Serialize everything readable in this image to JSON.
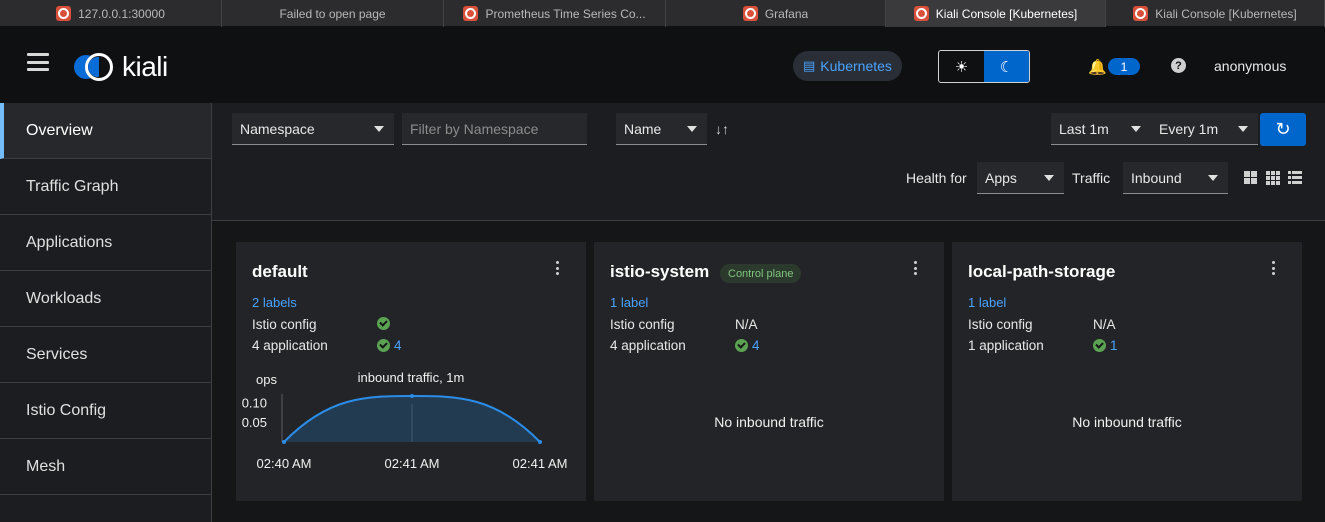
{
  "browser_tabs": [
    {
      "title": "127.0.0.1:30000",
      "favicon": true,
      "active": false
    },
    {
      "title": "Failed to open page",
      "favicon": false,
      "active": false
    },
    {
      "title": "Prometheus Time Series Co...",
      "favicon": true,
      "active": false
    },
    {
      "title": "Grafana",
      "favicon": true,
      "active": false
    },
    {
      "title": "Kiali Console [Kubernetes]",
      "favicon": true,
      "active": true
    },
    {
      "title": "Kiali Console [Kubernetes]",
      "favicon": true,
      "active": false
    }
  ],
  "masthead": {
    "logo_text": "kiali",
    "cluster": "Kubernetes",
    "notification_count": "1",
    "user": "anonymous",
    "help_glyph": "?"
  },
  "sidebar": {
    "items": [
      {
        "label": "Overview",
        "active": true
      },
      {
        "label": "Traffic Graph",
        "active": false
      },
      {
        "label": "Applications",
        "active": false
      },
      {
        "label": "Workloads",
        "active": false
      },
      {
        "label": "Services",
        "active": false
      },
      {
        "label": "Istio Config",
        "active": false
      },
      {
        "label": "Mesh",
        "active": false
      }
    ]
  },
  "toolbar": {
    "filter_type": "Namespace",
    "filter_placeholder": "Filter by Namespace",
    "sort_by": "Name",
    "time_range": "Last 1m",
    "refresh_interval": "Every 1m",
    "health_for_label": "Health for",
    "health_for_value": "Apps",
    "traffic_label": "Traffic",
    "traffic_value": "Inbound"
  },
  "cards": [
    {
      "name": "default",
      "badge": "",
      "labels_link": "2 labels",
      "istio_config_label": "Istio config",
      "istio_config_value": "",
      "istio_config_ok": true,
      "app_label": "4 application",
      "app_count": "4",
      "no_traffic": ""
    },
    {
      "name": "istio-system",
      "badge": "Control plane",
      "labels_link": "1 label",
      "istio_config_label": "Istio config",
      "istio_config_value": "N/A",
      "istio_config_ok": false,
      "app_label": "4 application",
      "app_count": "4",
      "no_traffic": "No inbound traffic"
    },
    {
      "name": "local-path-storage",
      "badge": "",
      "labels_link": "1 label",
      "istio_config_label": "Istio config",
      "istio_config_value": "N/A",
      "istio_config_ok": false,
      "app_label": "1 application",
      "app_count": "1",
      "no_traffic": "No inbound traffic"
    }
  ],
  "chart_data": {
    "type": "area",
    "title": "inbound traffic, 1m",
    "ylabel": "ops",
    "x": [
      "02:40 AM",
      "02:41 AM",
      "02:41 AM"
    ],
    "values": [
      0.0,
      0.12,
      0.0
    ],
    "yticks": [
      "0.10",
      "0.05"
    ],
    "ylim": [
      0,
      0.12
    ],
    "color": "#2b8de8"
  },
  "colors": {
    "accent": "#0066cc",
    "link": "#4aa3ff",
    "success": "#5ba352"
  }
}
